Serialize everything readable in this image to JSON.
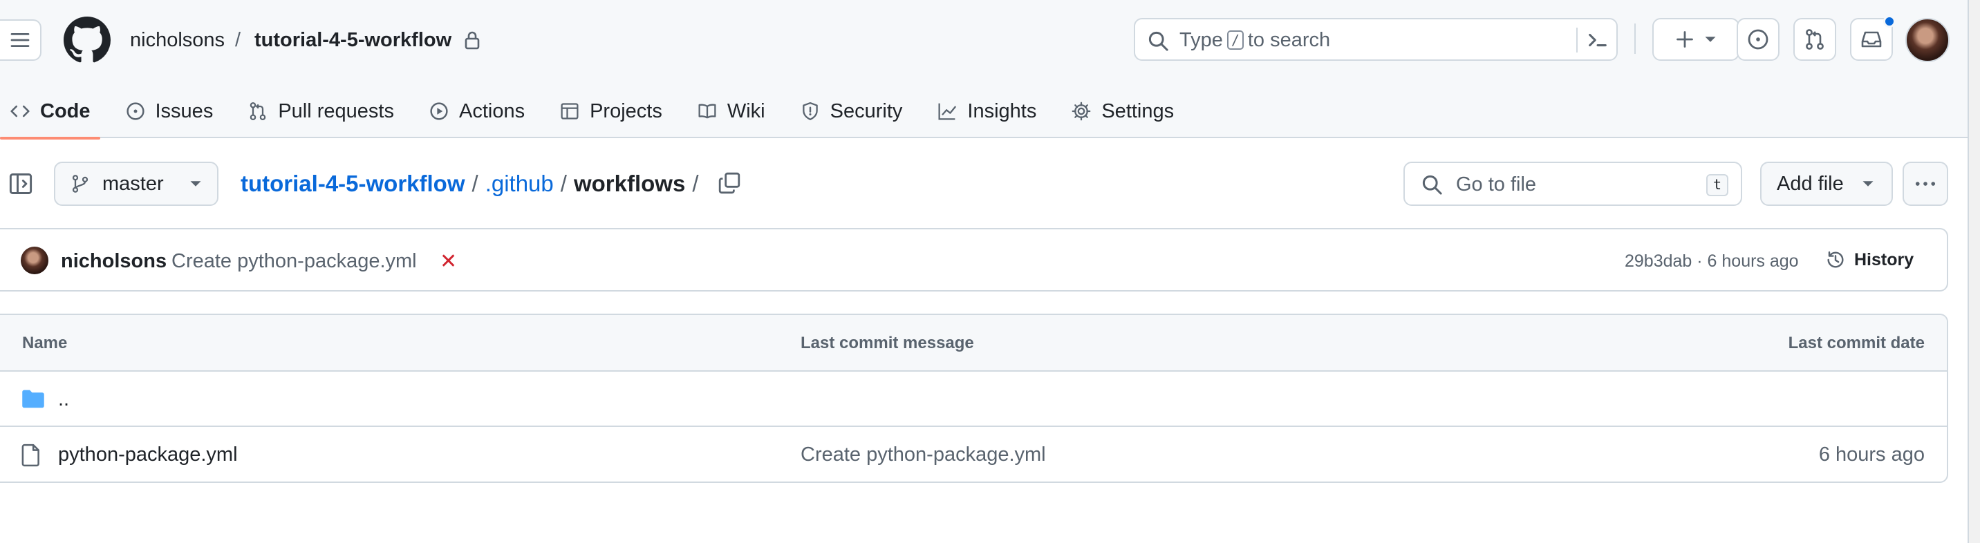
{
  "header": {
    "owner": "nicholsons",
    "separator": "/",
    "repo": "tutorial-4-5-workflow",
    "search": {
      "prefix": "Type",
      "key": "/",
      "suffix": "to search"
    }
  },
  "tabs": [
    {
      "label": "Code",
      "icon": "code-icon",
      "active": true
    },
    {
      "label": "Issues",
      "icon": "issue-opened-icon"
    },
    {
      "label": "Pull requests",
      "icon": "git-pull-request-icon"
    },
    {
      "label": "Actions",
      "icon": "play-icon"
    },
    {
      "label": "Projects",
      "icon": "table-icon"
    },
    {
      "label": "Wiki",
      "icon": "book-icon"
    },
    {
      "label": "Security",
      "icon": "shield-icon"
    },
    {
      "label": "Insights",
      "icon": "graph-icon"
    },
    {
      "label": "Settings",
      "icon": "gear-icon"
    }
  ],
  "nav": {
    "branch": "master",
    "breadcrumb": {
      "repo": "tutorial-4-5-workflow",
      "sep": "/",
      "folder": ".github",
      "current": "workflows",
      "trailing": "/"
    },
    "goto_placeholder": "Go to file",
    "goto_key": "t",
    "add_file": "Add file"
  },
  "commit": {
    "author": "nicholsons",
    "message": "Create python-package.yml",
    "status": "✕",
    "meta": "29b3dab · 6 hours ago",
    "history": "History"
  },
  "table": {
    "headers": {
      "name": "Name",
      "message": "Last commit message",
      "date": "Last commit date"
    },
    "parent": "..",
    "rows": [
      {
        "name": "python-package.yml",
        "message": "Create python-package.yml",
        "date": "6 hours ago"
      }
    ]
  },
  "colors": {
    "link": "#0969da",
    "active_tab_underline": "#fd8c73",
    "error": "#d1242f",
    "folder": "#54aeff"
  }
}
